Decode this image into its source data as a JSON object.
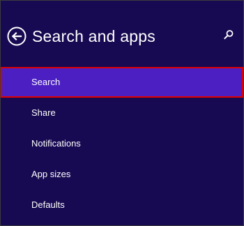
{
  "header": {
    "title": "Search and apps",
    "back_icon": "arrow-left-circle-icon",
    "search_icon": "magnifier-icon"
  },
  "menu": {
    "items": [
      {
        "label": "Search",
        "selected": true
      },
      {
        "label": "Share",
        "selected": false
      },
      {
        "label": "Notifications",
        "selected": false
      },
      {
        "label": "App sizes",
        "selected": false
      },
      {
        "label": "Defaults",
        "selected": false
      }
    ]
  },
  "colors": {
    "background": "#180a52",
    "selected_item": "#4b1fc2",
    "selection_outline": "#e00000",
    "text": "#ffffff"
  }
}
